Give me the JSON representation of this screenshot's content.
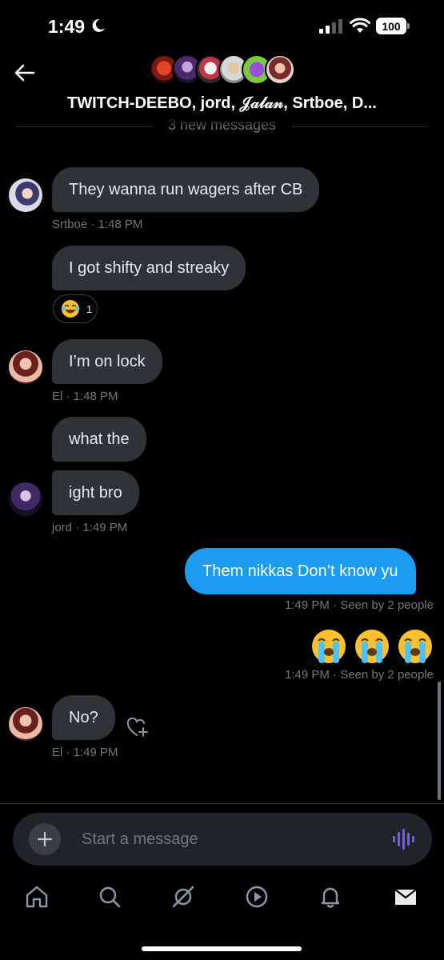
{
  "status_bar": {
    "time": "1:49",
    "battery": "100"
  },
  "header": {
    "title": "TWITCH-DEEBO, jord, 𝒥𝒶𝓁𝒶𝓃, Srtboe, D..."
  },
  "divider": {
    "label": "3 new messages"
  },
  "messages": [
    {
      "sender": "Srtboe",
      "text": "They wanna run wagers after CB",
      "meta": "Srtboe · 1:48 PM"
    },
    {
      "sender": "Srtboe",
      "text": "I got shifty and streaky",
      "reaction_count": "1"
    },
    {
      "sender": "El",
      "text": "I’m on lock",
      "meta": "El · 1:48 PM"
    },
    {
      "sender": "jord",
      "text": "what the"
    },
    {
      "sender": "jord",
      "text": "ight bro",
      "meta": "jord · 1:49 PM"
    },
    {
      "sender": "me",
      "text": "Them nikkas Don’t know yu",
      "meta": "1:49 PM · Seen by 2 people"
    },
    {
      "sender": "me",
      "text": "😭 😭 😭",
      "meta": "1:49 PM · Seen by 2 people"
    },
    {
      "sender": "El",
      "text": "No?",
      "meta": "El · 1:49 PM"
    }
  ],
  "composer": {
    "placeholder": "Start a message"
  },
  "nav": [
    "home-icon",
    "search-icon",
    "grok-icon",
    "video-icon",
    "notifications-icon",
    "messages-icon"
  ],
  "colors": {
    "accent": "#1d9bf0",
    "bubble_in": "#2f3336",
    "voice": "#7856ff"
  }
}
